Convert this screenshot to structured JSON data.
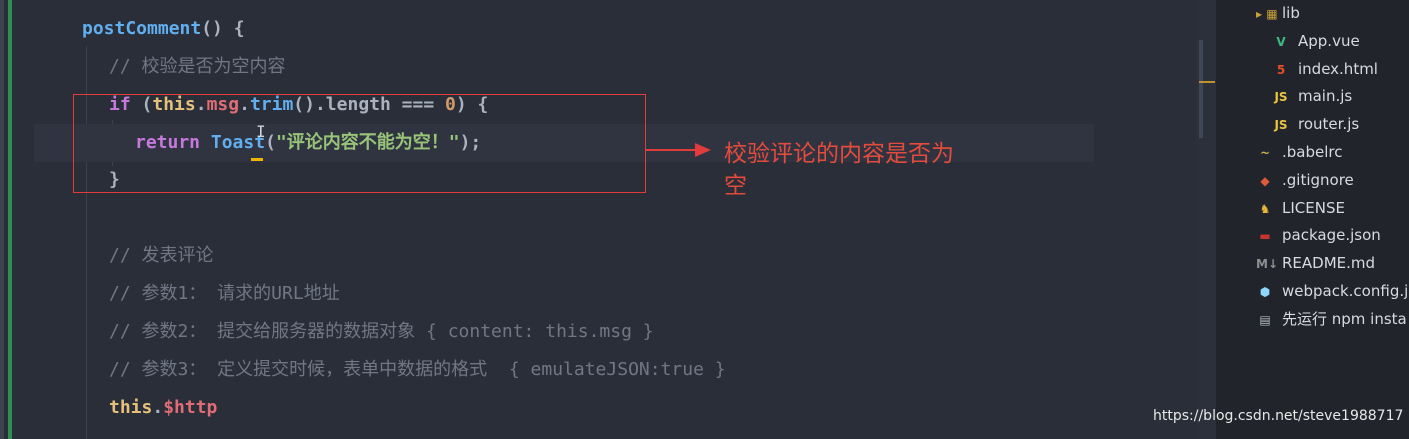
{
  "code": {
    "l1": {
      "fn": "postComment",
      "punc": "() {"
    },
    "l2": {
      "comment": "// 校验是否为空内容"
    },
    "l3": {
      "kw_if": "if",
      "p1": " (",
      "this": "this",
      "dot1": ".",
      "prop": "msg",
      "dot2": ".",
      "fn": "trim",
      "rest": "().length === ",
      "num": "0",
      "end": ") {"
    },
    "l4": {
      "kw_return": "return",
      "sp": " ",
      "fn": "Toast",
      "p1": "(",
      "str": "\"评论内容不能为空！\"",
      "end": ");"
    },
    "l5": {
      "brace": "}"
    },
    "l6": {
      "comment": "// 发表评论"
    },
    "l7": {
      "comment": "// 参数1： 请求的URL地址"
    },
    "l8": {
      "comment": "// 参数2： 提交给服务器的数据对象 { content: this.msg }"
    },
    "l9": {
      "comment": "// 参数3： 定义提交时候，表单中数据的格式  { emulateJSON:true }"
    },
    "l10": {
      "this": "this",
      "dot": ".",
      "prop": "$http"
    }
  },
  "annotation": {
    "text": "校验评论的内容是否为空"
  },
  "file_tree": [
    {
      "icon": "folder-icon",
      "glyph": "▸ ▦",
      "label": "lib",
      "color": "#c9a23b"
    },
    {
      "icon": "vue-icon",
      "glyph": "V",
      "label": "App.vue",
      "color": "#41b883"
    },
    {
      "icon": "html5-icon",
      "glyph": "5",
      "label": "index.html",
      "color": "#e44d26"
    },
    {
      "icon": "js-icon",
      "glyph": "JS",
      "label": "main.js",
      "color": "#e8c441"
    },
    {
      "icon": "js-icon",
      "glyph": "JS",
      "label": "router.js",
      "color": "#e8c441"
    },
    {
      "icon": "babel-icon",
      "glyph": "~",
      "label": ".babelrc",
      "color": "#c9b14a"
    },
    {
      "icon": "git-icon",
      "glyph": "◆",
      "label": ".gitignore",
      "color": "#e05a3a"
    },
    {
      "icon": "license-icon",
      "glyph": "♞",
      "label": "LICENSE",
      "color": "#e8b93b"
    },
    {
      "icon": "npm-icon",
      "glyph": "▬",
      "label": "package.json",
      "color": "#c6362f"
    },
    {
      "icon": "markdown-icon",
      "glyph": "M↓",
      "label": "README.md",
      "color": "#8f8f8f"
    },
    {
      "icon": "webpack-icon",
      "glyph": "⬢",
      "label": "webpack.config.js",
      "color": "#8ed6fb"
    },
    {
      "icon": "text-file-icon",
      "glyph": "▤",
      "label": "先运行 npm insta",
      "color": "#b5b9c0"
    }
  ],
  "watermark": "https://blog.csdn.net/steve1988717"
}
